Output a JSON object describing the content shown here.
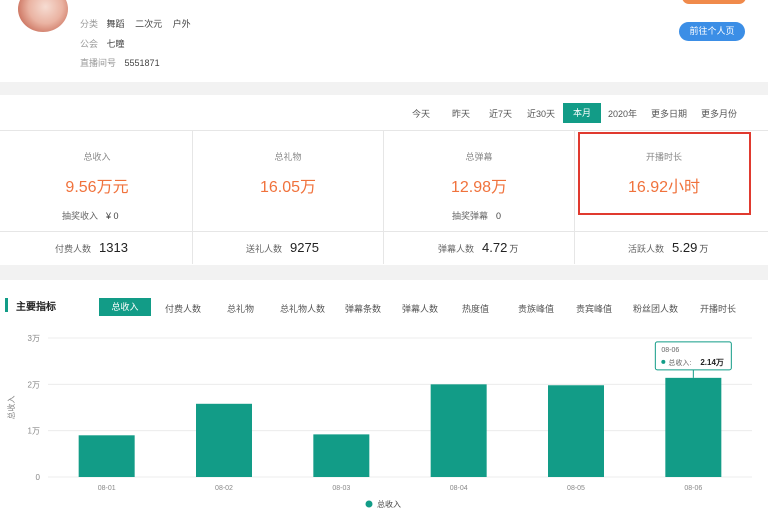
{
  "profile": {
    "category_label": "分类",
    "categories": [
      "舞蹈",
      "二次元",
      "户外"
    ],
    "guild_label": "公会",
    "guild": "七瞳",
    "room_label": "直播间号",
    "room_id": "5551871",
    "profile_button": "前往个人页"
  },
  "time_tabs": [
    "今天",
    "昨天",
    "近7天",
    "近30天",
    "本月",
    "2020年",
    "更多日期",
    "更多月份"
  ],
  "active_time_tab": "本月",
  "cards": [
    {
      "title": "总收入",
      "value": "9.56万元",
      "sub_label": "抽奖收入",
      "sub_value": "¥ 0"
    },
    {
      "title": "总礼物",
      "value": "16.05万",
      "sub_label": "",
      "sub_value": ""
    },
    {
      "title": "总弹幕",
      "value": "12.98万",
      "sub_label": "抽奖弹幕",
      "sub_value": "0"
    },
    {
      "title": "开播时长",
      "value": "16.92小时",
      "sub_label": "",
      "sub_value": ""
    }
  ],
  "bottom_stats": [
    {
      "label": "付费人数",
      "value": "1313",
      "unit": ""
    },
    {
      "label": "送礼人数",
      "value": "9275",
      "unit": ""
    },
    {
      "label": "弹幕人数",
      "value": "4.72",
      "unit": "万"
    },
    {
      "label": "活跃人数",
      "value": "5.29",
      "unit": "万"
    }
  ],
  "metrics": {
    "title": "主要指标",
    "tabs": [
      "总收入",
      "付费人数",
      "总礼物",
      "总礼物人数",
      "弹幕条数",
      "弹幕人数",
      "热度值",
      "贵族峰值",
      "贵宾峰值",
      "粉丝团人数",
      "开播时长"
    ],
    "active_tab": "总收入"
  },
  "chart_data": {
    "type": "bar",
    "categories": [
      "08-01",
      "08-02",
      "08-03",
      "08-04",
      "08-05",
      "08-06"
    ],
    "series": [
      {
        "name": "总收入",
        "values": [
          0.9,
          1.58,
          0.92,
          2.0,
          1.98,
          2.14
        ],
        "color": "#129c87"
      }
    ],
    "ylabel": "总收入",
    "ylim": [
      0,
      3
    ],
    "y_ticks": [
      "0",
      "1万",
      "2万",
      "3万"
    ],
    "grid": true,
    "legend": "bottom",
    "tooltip": {
      "date": "08-06",
      "label": "总收入:",
      "value": "2.14万"
    }
  }
}
